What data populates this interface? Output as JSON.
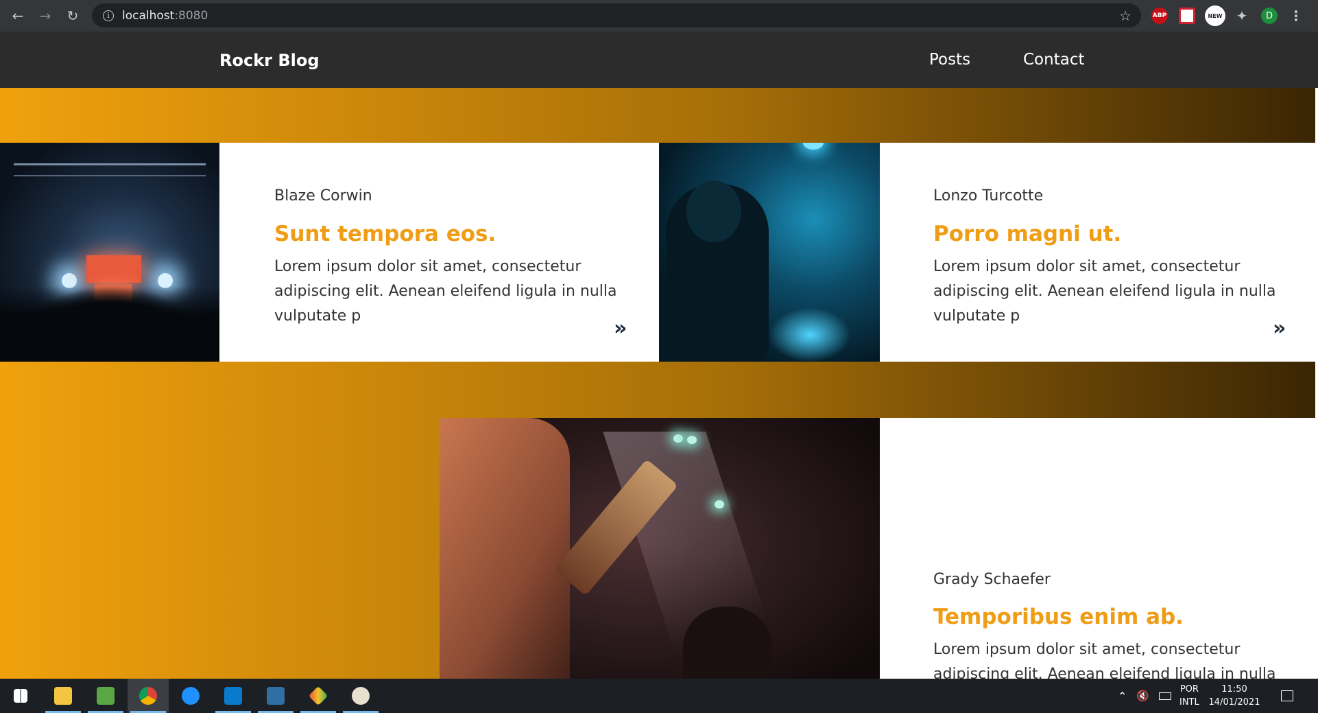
{
  "browser": {
    "url_host": "localhost",
    "url_port": ":8080",
    "extensions": [
      "ABP",
      "NEW",
      "D"
    ]
  },
  "site": {
    "brand": "Rockr Blog",
    "nav": [
      "Posts",
      "Contact"
    ]
  },
  "posts": [
    {
      "author": "Blaze Corwin",
      "title": "Sunt tempora eos.",
      "excerpt": "Lorem ipsum dolor sit amet, consectetur adipiscing elit. Aenean eleifend ligula in nulla vulputate p",
      "more": "»"
    },
    {
      "author": "Lonzo Turcotte",
      "title": "Porro magni ut.",
      "excerpt": "Lorem ipsum dolor sit amet, consectetur adipiscing elit. Aenean eleifend ligula in nulla vulputate p",
      "more": "»"
    },
    {
      "author": "Grady Schaefer",
      "title": "Temporibus enim ab.",
      "excerpt": "Lorem ipsum dolor sit amet, consectetur adipiscing elit. Aenean eleifend ligula in nulla"
    }
  ],
  "taskbar": {
    "language": "POR",
    "layout": "INTL",
    "time": "11:50",
    "date": "14/01/2021"
  },
  "colors": {
    "accent": "#f09d16",
    "header_bg": "#2c2c2c",
    "gradient_start": "#f0a10d",
    "gradient_end": "#3a2504"
  }
}
